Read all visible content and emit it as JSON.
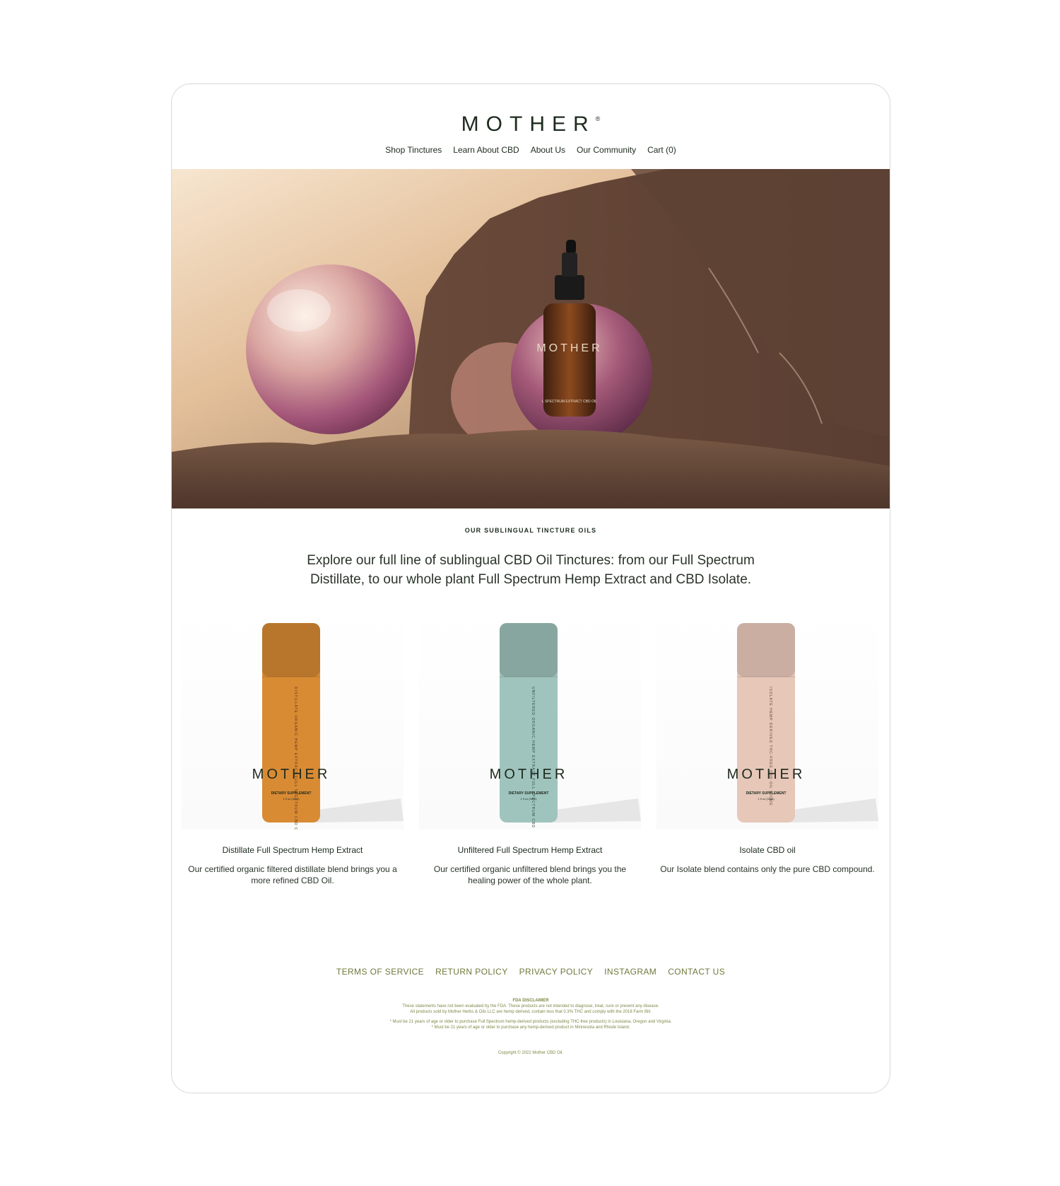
{
  "brand": {
    "logo_text": "MOTHER",
    "logo_mark": "®"
  },
  "nav": {
    "items": [
      {
        "label": "Shop Tinctures"
      },
      {
        "label": "Learn About CBD"
      },
      {
        "label": "About Us"
      },
      {
        "label": "Our Community"
      },
      {
        "label": "Cart (0)"
      }
    ]
  },
  "hero": {
    "bottle_label": "MOTHER",
    "bottle_sub": "L SPECTRUM EXTRACT CBD OIL"
  },
  "section": {
    "eyebrow": "OUR SUBLINGUAL TINCTURE OILS",
    "intro": "Explore our full line of sublingual CBD Oil Tinctures: from our Full Spectrum Distillate, to our whole plant Full Spectrum Hemp Extract and CBD Isolate."
  },
  "products": [
    {
      "name": "Distillate Full Spectrum Hemp Extract",
      "description": "Our certified organic filtered distillate blend brings you a more refined CBD Oil.",
      "tube_color": "#d98b34",
      "tube_text": "DISTILLATE ORGANIC HEMP EXTRACT FULL SPECTRUM CBD OIL 500MG",
      "tube_brand": "MOTHER",
      "tube_footer": "DIETARY SUPPLEMENT",
      "tube_volume": "1 fl oz (30ml)"
    },
    {
      "name": "Unfiltered Full Spectrum Hemp Extract",
      "description": "Our certified organic unfiltered blend brings you the healing power of the whole plant.",
      "tube_color": "#9fc4bd",
      "tube_text": "UNFILTERED ORGANIC HEMP EXTRACT FULL SPECTRUM CBD OIL 1000MG",
      "tube_brand": "MOTHER",
      "tube_footer": "DIETARY SUPPLEMENT",
      "tube_volume": "1 fl oz (30ml)"
    },
    {
      "name": "Isolate CBD oil",
      "description": "Our Isolate blend contains only the pure CBD compound.",
      "tube_color": "#e6c7b8",
      "tube_text": "ISOLATE HEMP DERIVED THC-FREE CBD OIL 500MG",
      "tube_brand": "MOTHER",
      "tube_footer": "DIETARY SUPPLEMENT",
      "tube_volume": "1 fl oz (30ml)"
    }
  ],
  "footer": {
    "links": [
      {
        "label": "TERMS OF SERVICE"
      },
      {
        "label": "RETURN POLICY"
      },
      {
        "label": "PRIVACY POLICY"
      },
      {
        "label": "INSTAGRAM"
      },
      {
        "label": "CONTACT US"
      }
    ],
    "disclaimer_title": "FDA DISCLAIMER",
    "disclaimer_line1": "These statements have not been evaluated by the FDA. These products are not intended to diagnose, treat, cure or prevent any disease.",
    "disclaimer_line2": "All products sold by Mother Herbs & Oils LLC are hemp derived, contain less that 0.3% THC and comply with the 2018 Farm Bill.",
    "age_line1": "* Must be 21 years of age or older to purchase Full Spectrum hemp-derived products (excluding THC-free products) in Louisiana, Oregon and Virginia.",
    "age_line2": "* Must be 21 years of age or older to purchase any hemp-derived product in Minnesota and Rhode Island.",
    "copyright": "Copyright © 2022 Mother CBD Oil."
  },
  "colors": {
    "brand_dark": "#1d2b1e",
    "footer_olive": "#6e7a3c"
  }
}
